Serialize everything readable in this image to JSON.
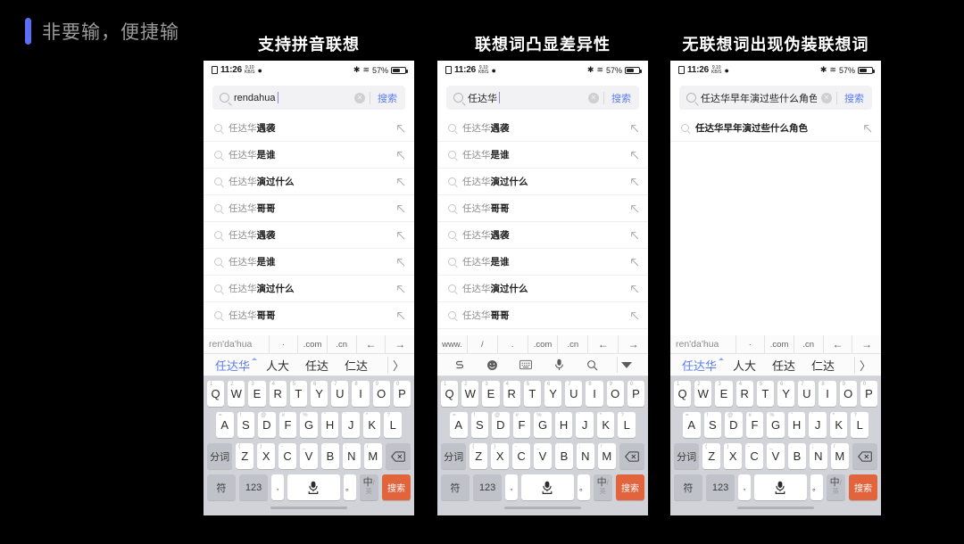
{
  "heading": {
    "text": "非要输，便捷输",
    "accent_color": "#5b6ef5"
  },
  "columns": [
    {
      "title": "支持拼音联想"
    },
    {
      "title": "联想词凸显差异性"
    },
    {
      "title": "无联想词出现伪装联想词"
    }
  ],
  "status_bar": {
    "time": "11:26",
    "netspeed_top": "9.10",
    "netspeed_bottom": "KB/S",
    "battery_percent": "57%",
    "bluetooth_icon": "bluetooth-icon",
    "wifi_icon": "wifi-icon",
    "sim_icon": "sim-card-icon",
    "info_icon": "info-dot-icon"
  },
  "search_action_label": "搜索",
  "search_action_color": "#5b7cf0",
  "phones": [
    {
      "id": "phone-1",
      "query": "rendahua",
      "query_prefix": "",
      "query_bold": "",
      "suggestions": [
        {
          "prefix": "任达华",
          "suffix": "遇袭"
        },
        {
          "prefix": "任达华",
          "suffix": "是谁"
        },
        {
          "prefix": "任达华",
          "suffix": "演过什么"
        },
        {
          "prefix": "任达华",
          "suffix": "哥哥"
        },
        {
          "prefix": "任达华",
          "suffix": "遇袭"
        },
        {
          "prefix": "任达华",
          "suffix": "是谁"
        },
        {
          "prefix": "任达华",
          "suffix": "演过什么"
        },
        {
          "prefix": "任达华",
          "suffix": "哥哥"
        }
      ],
      "toolbar_type": "pinyin",
      "toolbar": {
        "pinyin": "ren'da'hua",
        "items": [
          "·",
          ".com",
          ".cn"
        ],
        "back_arrow": "←",
        "forward_arrow": "→"
      },
      "candidates": [
        "任达华",
        "人大",
        "任达",
        "仁达"
      ],
      "candidates_more": "〉"
    },
    {
      "id": "phone-2",
      "query": "任达华",
      "suggestions": [
        {
          "prefix": "任达华",
          "suffix": "遇袭"
        },
        {
          "prefix": "任达华",
          "suffix": "是谁"
        },
        {
          "prefix": "任达华",
          "suffix": "演过什么"
        },
        {
          "prefix": "任达华",
          "suffix": "哥哥"
        },
        {
          "prefix": "任达华",
          "suffix": "遇袭"
        },
        {
          "prefix": "任达华",
          "suffix": "是谁"
        },
        {
          "prefix": "任达华",
          "suffix": "演过什么"
        },
        {
          "prefix": "任达华",
          "suffix": "哥哥"
        }
      ],
      "toolbar_type": "icons",
      "toolbar": {
        "items": [
          "www.",
          "/",
          ".",
          ".com",
          ".cn"
        ],
        "back_arrow": "←",
        "forward_arrow": "→"
      },
      "icon_row": [
        "sogou-logo-icon",
        "emoji-icon",
        "keyboard-icon",
        "microphone-icon",
        "search-icon",
        "collapse-chevron-icon"
      ]
    },
    {
      "id": "phone-3",
      "query": "任达华早年演过些什么角色",
      "suggestions": [
        {
          "prefix": "",
          "suffix": "任达华早年演过些什么角色"
        }
      ],
      "toolbar_type": "pinyin",
      "toolbar": {
        "pinyin": "ren'da'hua",
        "items": [
          "·",
          ".com",
          ".cn"
        ],
        "back_arrow": "←",
        "forward_arrow": "→"
      },
      "candidates": [
        "任达华",
        "人大",
        "任达",
        "仁达"
      ],
      "candidates_more": "〉"
    }
  ],
  "keyboard": {
    "row1": [
      {
        "key": "Q",
        "sup": "1"
      },
      {
        "key": "W",
        "sup": "2"
      },
      {
        "key": "E",
        "sup": "3"
      },
      {
        "key": "R",
        "sup": "4"
      },
      {
        "key": "T",
        "sup": "5"
      },
      {
        "key": "Y",
        "sup": "6"
      },
      {
        "key": "U",
        "sup": "7"
      },
      {
        "key": "I",
        "sup": "8"
      },
      {
        "key": "O",
        "sup": "9"
      },
      {
        "key": "P",
        "sup": "0"
      }
    ],
    "row2": [
      {
        "key": "A",
        "sup": "="
      },
      {
        "key": "S",
        "sup": "!"
      },
      {
        "key": "D",
        "sup": "@"
      },
      {
        "key": "F",
        "sup": "#"
      },
      {
        "key": "G",
        "sup": "%"
      },
      {
        "key": "H",
        "sup": "\""
      },
      {
        "key": "J",
        "sup": "'"
      },
      {
        "key": "K",
        "sup": "*"
      },
      {
        "key": "L",
        "sup": "?"
      }
    ],
    "row3_fn": "分词",
    "row3": [
      {
        "key": "Z",
        "sup": "("
      },
      {
        "key": "X",
        "sup": ")"
      },
      {
        "key": "C",
        "sup": "-"
      },
      {
        "key": "V",
        "sup": "_"
      },
      {
        "key": "B",
        "sup": ":"
      },
      {
        "key": "N",
        "sup": ";"
      },
      {
        "key": "M",
        "sup": "/"
      }
    ],
    "backspace_icon": "backspace-icon",
    "row4": {
      "symbol": "符",
      "numbers": "123",
      "comma": "，",
      "space_icon": "microphone-space-icon",
      "period": "。",
      "lang_zh": "中",
      "lang_slash": "/",
      "lang_en": "英",
      "enter": "搜索"
    }
  }
}
